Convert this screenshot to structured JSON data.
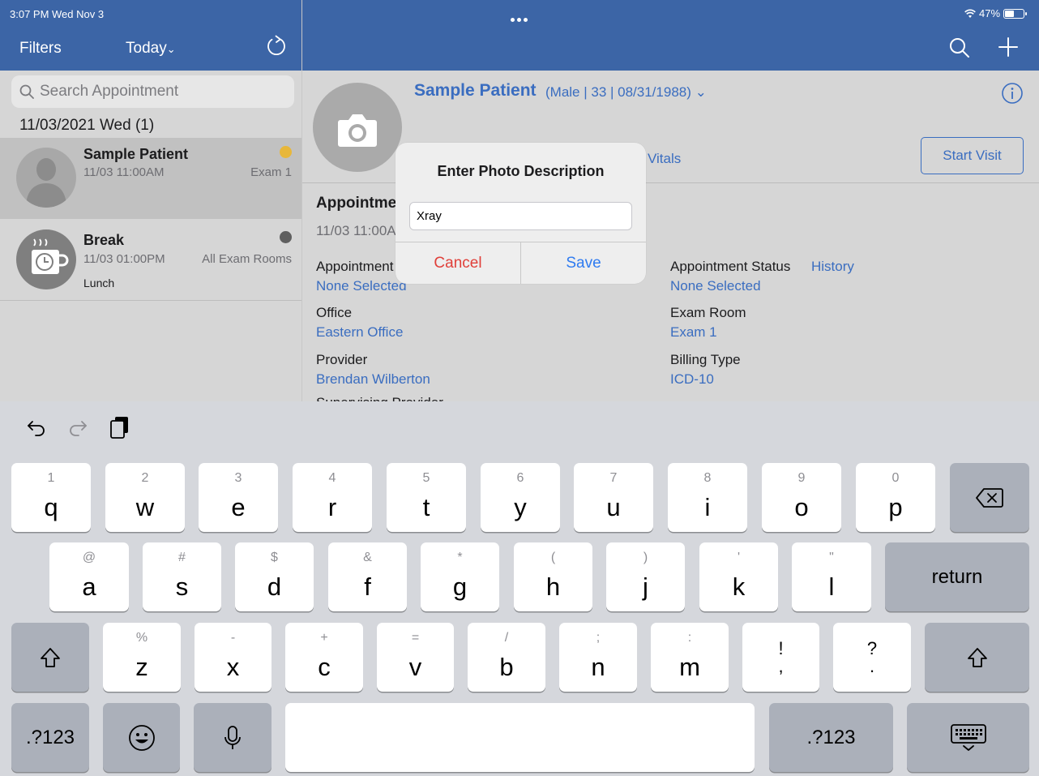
{
  "status_bar": {
    "time": "3:07 PM  Wed Nov 3",
    "battery": "47%"
  },
  "left_header": {
    "filters_label": "Filters",
    "today_label": "Today",
    "today_chevron": "⌄"
  },
  "search": {
    "placeholder": "Search Appointment"
  },
  "list": {
    "date_header": "11/03/2021 Wed (1)",
    "items": [
      {
        "name": "Sample Patient",
        "time": "11/03 11:00AM",
        "room": "Exam 1",
        "note": "",
        "status_color": "#e8b73a"
      },
      {
        "name": "Break",
        "time": "11/03 01:00PM",
        "room": "All Exam Rooms",
        "note": "Lunch",
        "status_color": "#5f5f5f"
      }
    ]
  },
  "patient": {
    "name": "Sample Patient",
    "meta": "(Male | 33 | 08/31/1988)",
    "meta_chevron": "⌄",
    "vitals_tab": "Vitals",
    "start_visit": "Start Visit"
  },
  "appointment": {
    "section_title": "Appointme",
    "time": "11/03 11:00A",
    "type_label": "Appointment",
    "type_value": "None Selected",
    "status_label": "Appointment Status",
    "status_history_link": "History",
    "status_value": "None Selected",
    "office_label": "Office",
    "office_value": "Eastern Office",
    "exam_room_label": "Exam Room",
    "exam_room_value": "Exam 1",
    "provider_label": "Provider",
    "provider_value": "Brendan Wilberton",
    "billing_type_label": "Billing Type",
    "billing_type_value": "ICD-10",
    "clipped_label": "Supervising Provider"
  },
  "dialog": {
    "title": "Enter Photo Description",
    "input_value": "Xray",
    "cancel_label": "Cancel",
    "save_label": "Save"
  },
  "keyboard": {
    "row1": [
      {
        "hint": "1",
        "key": "q"
      },
      {
        "hint": "2",
        "key": "w"
      },
      {
        "hint": "3",
        "key": "e"
      },
      {
        "hint": "4",
        "key": "r"
      },
      {
        "hint": "5",
        "key": "t"
      },
      {
        "hint": "6",
        "key": "y"
      },
      {
        "hint": "7",
        "key": "u"
      },
      {
        "hint": "8",
        "key": "i"
      },
      {
        "hint": "9",
        "key": "o"
      },
      {
        "hint": "0",
        "key": "p"
      }
    ],
    "row2": [
      {
        "hint": "@",
        "key": "a"
      },
      {
        "hint": "#",
        "key": "s"
      },
      {
        "hint": "$",
        "key": "d"
      },
      {
        "hint": "&",
        "key": "f"
      },
      {
        "hint": "*",
        "key": "g"
      },
      {
        "hint": "(",
        "key": "h"
      },
      {
        "hint": ")",
        "key": "j"
      },
      {
        "hint": "'",
        "key": "k"
      },
      {
        "hint": "\"",
        "key": "l"
      }
    ],
    "row3": [
      {
        "hint": "%",
        "key": "z"
      },
      {
        "hint": "-",
        "key": "x"
      },
      {
        "hint": "+",
        "key": "c"
      },
      {
        "hint": "=",
        "key": "v"
      },
      {
        "hint": "/",
        "key": "b"
      },
      {
        "hint": ";",
        "key": "n"
      },
      {
        "hint": ":",
        "key": "m"
      },
      {
        "hint": "!",
        "key": ","
      },
      {
        "hint": "?",
        "key": "."
      }
    ],
    "return_label": "return",
    "numbers_label": ".?123"
  },
  "colors": {
    "header_blue": "#3c65a6",
    "link_blue": "#3a6dc0",
    "destructive_red": "#e0403a"
  }
}
